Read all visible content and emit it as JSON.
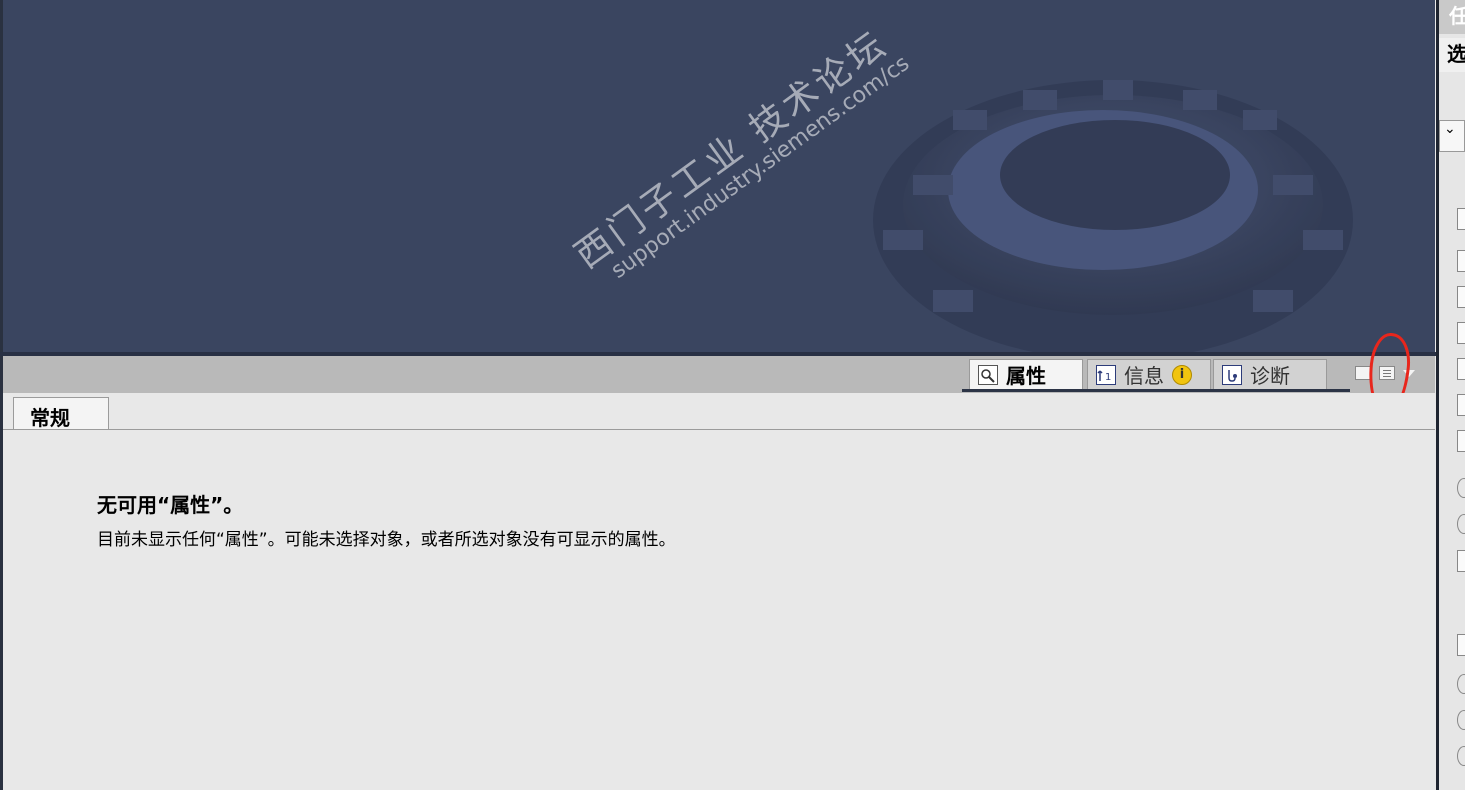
{
  "inspector": {
    "tabs": [
      {
        "label": "属性",
        "icon": "properties-magnifier-icon",
        "active": true
      },
      {
        "label": "信息",
        "icon": "info-list-icon",
        "badge_icon": "info-badge-icon"
      },
      {
        "label": "诊断",
        "icon": "diagnostics-icon"
      }
    ],
    "info_badge": "i",
    "controls": [
      "minimize-icon",
      "layout-menu-icon",
      "dropdown-caret-icon"
    ]
  },
  "content": {
    "section_tab": "常规",
    "title": "无可用“属性”。",
    "description": "目前未显示任何“属性”。可能未选择对象，或者所选对象没有可显示的属性。"
  },
  "watermark": {
    "line1": "西门子工业 技术论坛",
    "line2": "support.industry.siemens.com/cs"
  },
  "right_panel": {
    "header1": "任",
    "header2": "选",
    "dropdown_icon": "chevron-down-icon"
  },
  "colors": {
    "workspace_bg": "#3a4560",
    "annotation_red": "#e8261c",
    "info_yellow": "#f1c40f"
  }
}
